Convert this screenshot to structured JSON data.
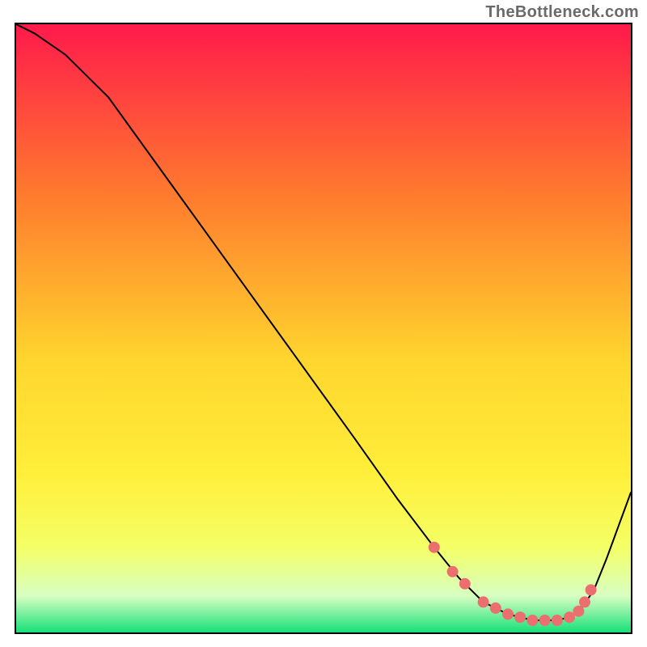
{
  "watermark": "TheBottleneck.com",
  "colors": {
    "gradient_top": "#ff1a4b",
    "gradient_mid1": "#ff7a2e",
    "gradient_mid2": "#ffd52e",
    "gradient_mid3": "#ffef3a",
    "gradient_mid4": "#f4ff66",
    "gradient_bottom_pale": "#d8ffc2",
    "gradient_bottom": "#17e07a",
    "curve": "#000000",
    "points": "#ec6f6f"
  },
  "chart_data": {
    "type": "line",
    "title": "",
    "xlabel": "",
    "ylabel": "",
    "xlim": [
      0,
      100
    ],
    "ylim": [
      0,
      100
    ],
    "series": [
      {
        "name": "curve",
        "x": [
          0,
          3,
          8,
          15,
          25,
          35,
          45,
          55,
          62,
          68,
          72,
          76,
          80,
          84,
          88,
          90,
          92,
          94,
          96,
          100
        ],
        "y": [
          100,
          98.5,
          95,
          88,
          74,
          60,
          46,
          32,
          22,
          14,
          9,
          5,
          3,
          2,
          2,
          2.5,
          4,
          7,
          12,
          23
        ]
      }
    ],
    "valley_points": {
      "name": "highlighted-points",
      "x": [
        68,
        71,
        73,
        76,
        78,
        80,
        82,
        84,
        86,
        88,
        90,
        91.5,
        92.5,
        93.5
      ],
      "y": [
        14,
        10,
        8,
        5,
        4,
        3,
        2.5,
        2,
        2,
        2,
        2.5,
        3.5,
        5,
        7
      ]
    }
  }
}
